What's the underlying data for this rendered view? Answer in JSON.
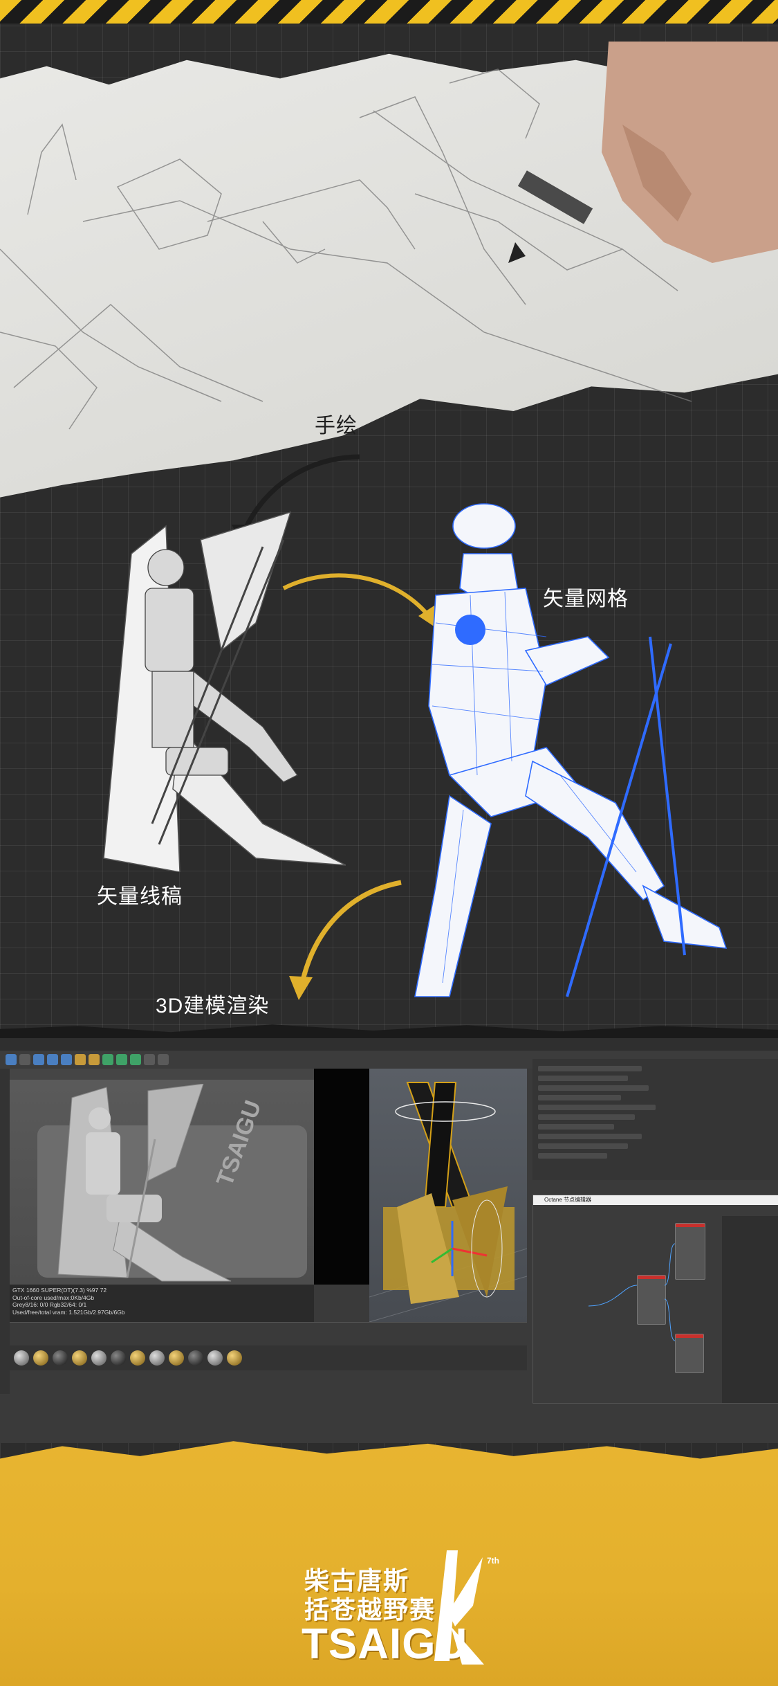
{
  "labels": {
    "hand_drawn": "手绘",
    "vector_mesh": "矢量网格",
    "vector_lineart": "矢量线稿",
    "modeling_render": "3D建模渲染"
  },
  "software": {
    "stats": {
      "line1": "GTX 1660 SUPER(DT)(7.3)   %97    72",
      "line2": "Out-of-core used/max:0Kb/4Gb",
      "line3": "Grey8/16: 0/0          Rgb32/64: 0/1",
      "line4": "Used/free/total vram: 1.521Gb/2.97Gb/6Gb"
    },
    "octane_window_title": "Octane 节点编辑器"
  },
  "logo": {
    "cn_line1": "柴古唐斯",
    "cn_line2": "括苍越野赛",
    "en": "TSAIGU",
    "superscript": "7th"
  },
  "colors": {
    "hazard_yellow": "#f0c020",
    "accent_gold": "#e8b531",
    "mesh_blue": "#2f6bff",
    "arrow_dark": "#1e1e1e"
  }
}
